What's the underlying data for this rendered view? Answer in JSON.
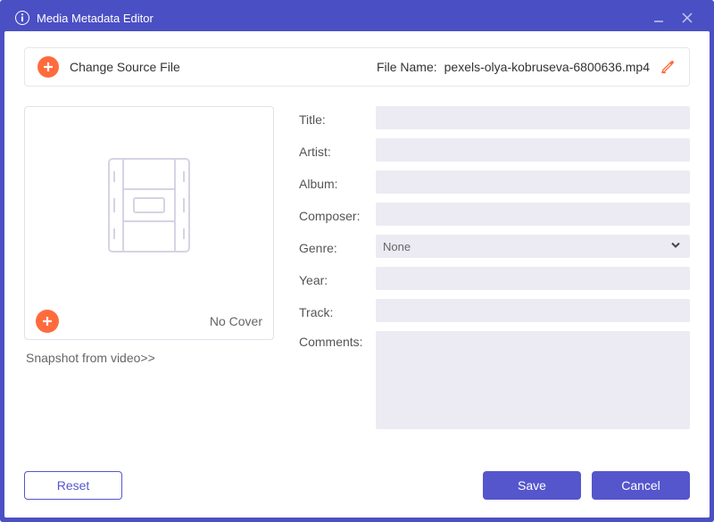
{
  "window": {
    "title": "Media Metadata Editor"
  },
  "topbar": {
    "change_source_label": "Change Source File",
    "file_name_label": "File Name:",
    "file_name_value": "pexels-olya-kobruseva-6800636.mp4"
  },
  "cover": {
    "no_cover_label": "No Cover",
    "snapshot_label": "Snapshot from video>>"
  },
  "fields": {
    "title": {
      "label": "Title:",
      "value": ""
    },
    "artist": {
      "label": "Artist:",
      "value": ""
    },
    "album": {
      "label": "Album:",
      "value": ""
    },
    "composer": {
      "label": "Composer:",
      "value": ""
    },
    "genre": {
      "label": "Genre:",
      "selected": "None"
    },
    "year": {
      "label": "Year:",
      "value": ""
    },
    "track": {
      "label": "Track:",
      "value": ""
    },
    "comments": {
      "label": "Comments:",
      "value": ""
    }
  },
  "footer": {
    "reset_label": "Reset",
    "save_label": "Save",
    "cancel_label": "Cancel"
  }
}
